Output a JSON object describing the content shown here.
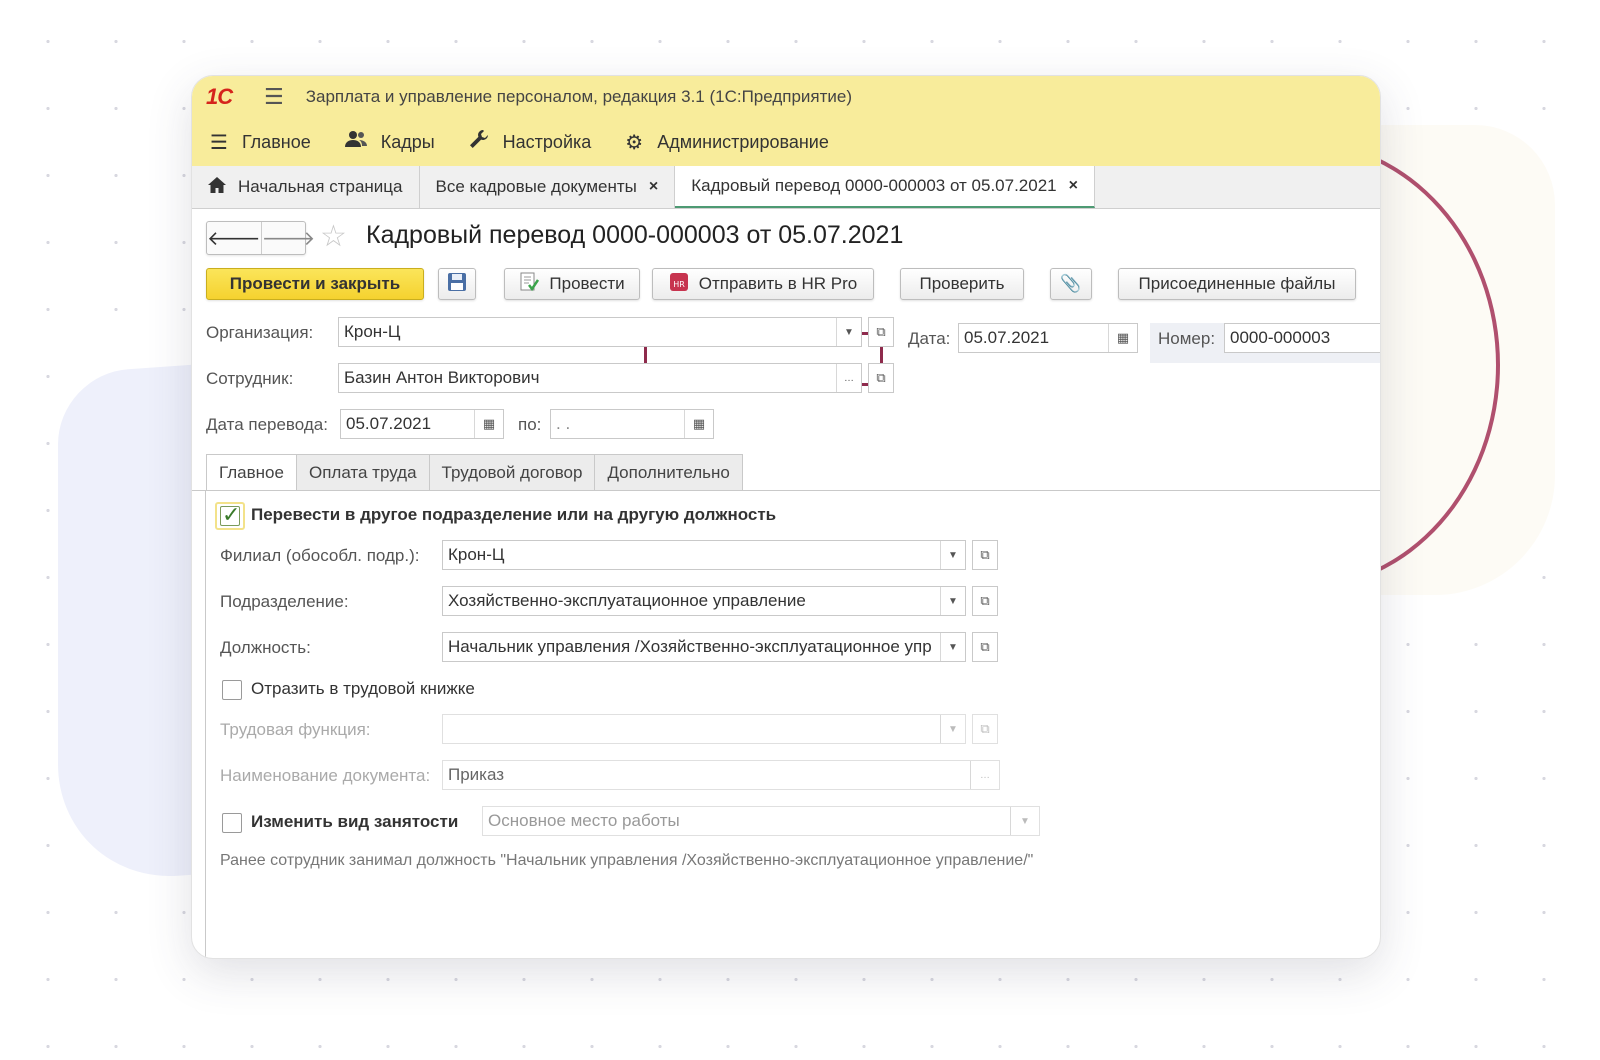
{
  "window": {
    "logo": "1С",
    "title": "Зарплата и управление персоналом, редакция 3.1  (1С:Предприятие)"
  },
  "menu": {
    "items": [
      {
        "label": "Главное",
        "icon": "menu-lines-icon"
      },
      {
        "label": "Кадры",
        "icon": "people-icon"
      },
      {
        "label": "Настройка",
        "icon": "wrench-icon"
      },
      {
        "label": "Администрирование",
        "icon": "gear-icon"
      }
    ]
  },
  "page_tabs": [
    {
      "label": "Начальная страница",
      "icon": "home-icon"
    },
    {
      "label": "Все кадровые документы"
    },
    {
      "label": "Кадровый перевод 0000-000003 от 05.07.2021"
    }
  ],
  "doc": {
    "title": "Кадровый перевод 0000-000003 от 05.07.2021"
  },
  "toolbar": {
    "post_close": "Провести и закрыть",
    "post": "Провести",
    "send_hr": "Отправить в HR Pro",
    "check": "Проверить",
    "attached": "Присоединенные файлы"
  },
  "header_fields": {
    "org_label": "Организация:",
    "org_value": "Крон-Ц",
    "date_label": "Дата:",
    "date_value": "05.07.2021",
    "number_label": "Номер:",
    "number_value": "0000-000003",
    "employee_label": "Сотрудник:",
    "employee_value": "Базин Антон Викторович",
    "transfer_date_label": "Дата перевода:",
    "transfer_date_value": "05.07.2021",
    "to_label": "по:",
    "to_value": " .  ."
  },
  "form_tabs": [
    "Главное",
    "Оплата труда",
    "Трудовой договор",
    "Дополнительно"
  ],
  "main_tab": {
    "transfer_checkbox": {
      "label": "Перевести в другое подразделение или на другую должность",
      "checked": true
    },
    "branch_label": "Филиал (обособл. подр.):",
    "branch_value": "Крон-Ц",
    "dept_label": "Подразделение:",
    "dept_value": "Хозяйственно-эксплуатационное управление",
    "position_label": "Должность:",
    "position_value": "Начальник управления /Хозяйственно-эксплуатационное упр",
    "workbook_checkbox": {
      "label": "Отразить в трудовой книжке",
      "checked": false
    },
    "labor_function_label": "Трудовая функция:",
    "labor_function_value": "",
    "doc_name_label": "Наименование документа:",
    "doc_name_value": "Приказ",
    "employment_checkbox": {
      "label": "Изменить вид занятости",
      "checked": false
    },
    "employment_value": "Основное место работы",
    "note": "Ранее сотрудник занимал должность \"Начальник управления /Хозяйственно-эксплуатационное управление/\""
  },
  "colors": {
    "title_bar": "#f8ec9b",
    "primary_button": "#f5d22f",
    "highlight": "#8e2a4c",
    "ring": "#b0506e"
  }
}
